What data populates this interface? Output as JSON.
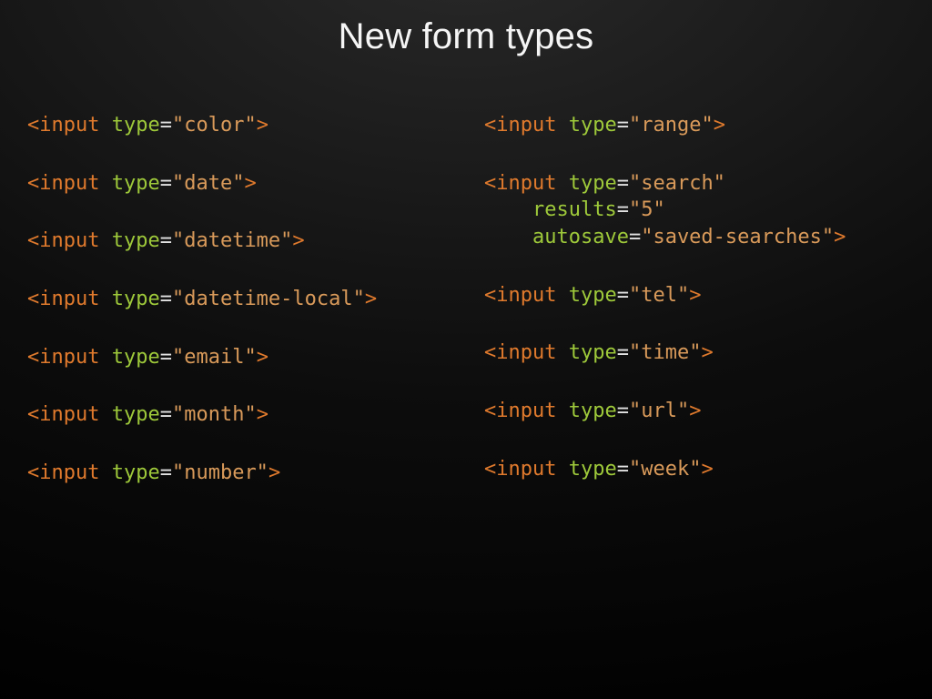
{
  "title": "New form types",
  "tokens": {
    "lt": "<",
    "gt": ">",
    "eq": "=",
    "input": "input",
    "space": " ",
    "type": "type",
    "results": "results",
    "autosave": "autosave"
  },
  "left": [
    {
      "value": "\"color\""
    },
    {
      "value": "\"date\""
    },
    {
      "value": "\"datetime\""
    },
    {
      "value": "\"datetime-local\""
    },
    {
      "value": "\"email\""
    },
    {
      "value": "\"month\""
    },
    {
      "value": "\"number\""
    }
  ],
  "right_simple": {
    "range": "\"range\"",
    "tel": "\"tel\"",
    "time": "\"time\"",
    "url": "\"url\"",
    "week": "\"week\""
  },
  "search": {
    "type_value": "\"search\"",
    "indent": "    ",
    "results_value": "\"5\"",
    "autosave_value": "\"saved-searches\""
  }
}
